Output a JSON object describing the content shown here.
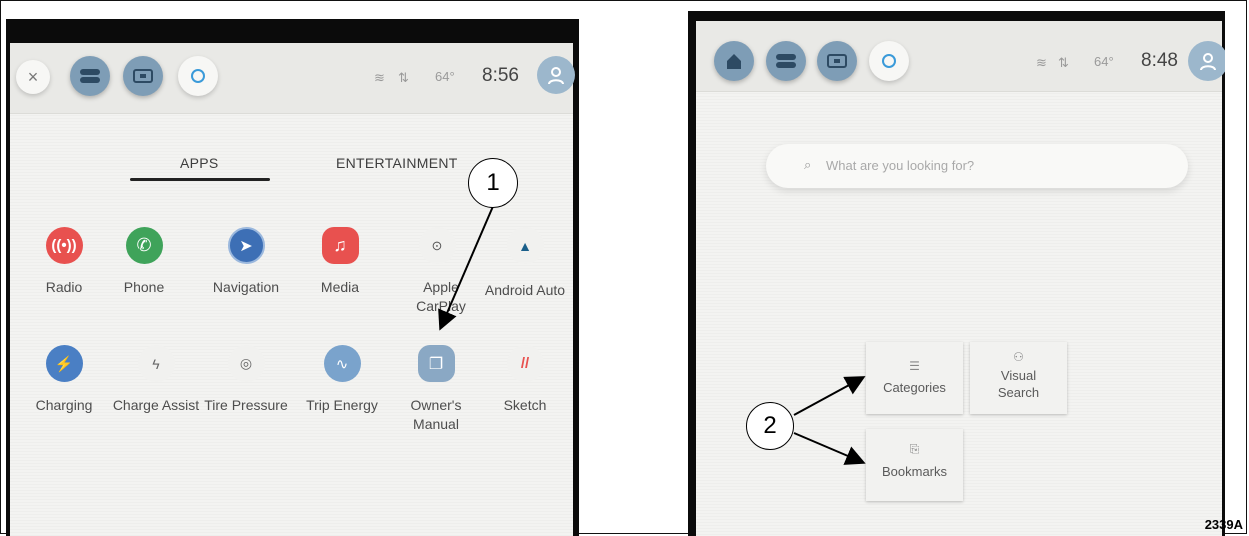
{
  "left_screen": {
    "status": {
      "temperature": "64°",
      "time": "8:56"
    },
    "tabs": [
      {
        "label": "APPS",
        "active": true
      },
      {
        "label": "ENTERTAINMENT",
        "active": false
      }
    ],
    "apps_row1": [
      {
        "label": "Radio",
        "icon": "radio-icon"
      },
      {
        "label": "Phone",
        "icon": "phone-icon"
      },
      {
        "label": "Navigation",
        "icon": "navigation-icon"
      },
      {
        "label": "Media",
        "icon": "music-note-icon"
      },
      {
        "label": "Apple CarPlay",
        "icon": "carplay-icon"
      },
      {
        "label": "Android Auto",
        "icon": "android-auto-icon"
      }
    ],
    "apps_row2": [
      {
        "label": "Charging",
        "icon": "ev-charging-icon"
      },
      {
        "label": "Charge Assist",
        "icon": "charge-assist-icon"
      },
      {
        "label": "Tire Pressure",
        "icon": "tire-icon"
      },
      {
        "label": "Trip Energy",
        "icon": "trip-energy-icon"
      },
      {
        "label": "Owner's Manual",
        "icon": "book-icon"
      },
      {
        "label": "Sketch",
        "icon": "sketch-icon"
      }
    ]
  },
  "right_screen": {
    "status": {
      "temperature": "64°",
      "time": "8:48"
    },
    "search": {
      "placeholder": "What are you looking for?"
    },
    "cards": {
      "categories": "Categories",
      "visual_search": "Visual Search",
      "bookmarks": "Bookmarks"
    }
  },
  "callouts": {
    "one": "1",
    "two": "2"
  },
  "figure_ref": "2339A",
  "colors": {
    "radio": "#e8514f",
    "phone": "#3fa35a",
    "navigation": "#3d6fb5",
    "media": "#e8514f",
    "charging": "#4a7fc4",
    "trip_energy": "#7aa3cc",
    "manual": "#8aa8c4",
    "accent_button": "#7e9db6"
  }
}
